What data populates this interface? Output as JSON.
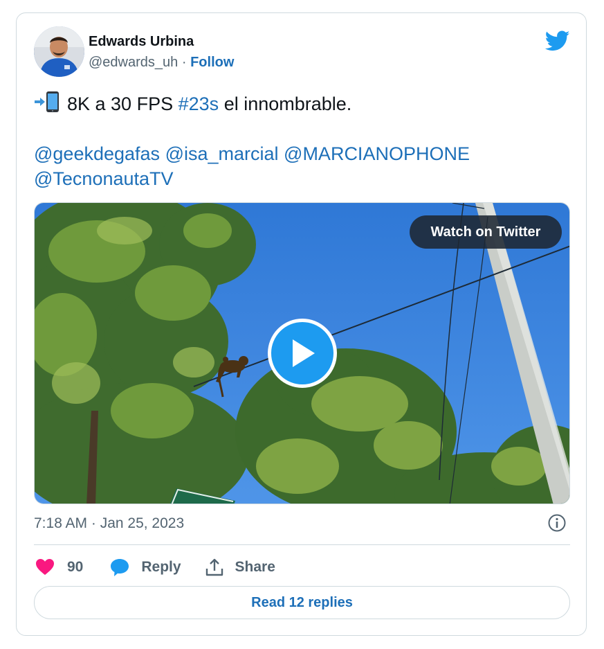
{
  "author": {
    "name": "Edwards Urbina",
    "handle": "@edwards_uh",
    "separator": "·",
    "follow_label": "Follow"
  },
  "tweet": {
    "line1_prefix": "8K a 30 FPS",
    "hashtag": "#23s",
    "line1_suffix": "el innombrable.",
    "mentions": [
      "@geekdegafas",
      "@isa_marcial",
      "@MARCIANOPHONE",
      "@TecnonautaTV"
    ]
  },
  "media": {
    "watch_label": "Watch on Twitter"
  },
  "meta": {
    "timestamp": "7:18 AM · Jan 25, 2023"
  },
  "actions": {
    "like_count": "90",
    "reply_label": "Reply",
    "share_label": "Share"
  },
  "footer": {
    "read_replies_label": "Read 12 replies"
  },
  "colors": {
    "link": "#1d6fb8",
    "twitter_blue": "#1d9bf0",
    "heart": "#f91880",
    "muted": "#536471"
  },
  "icons": [
    "phone-arrow-icon",
    "twitter-bird-icon",
    "play-icon",
    "info-icon",
    "heart-icon",
    "reply-bubble-icon",
    "share-icon"
  ]
}
